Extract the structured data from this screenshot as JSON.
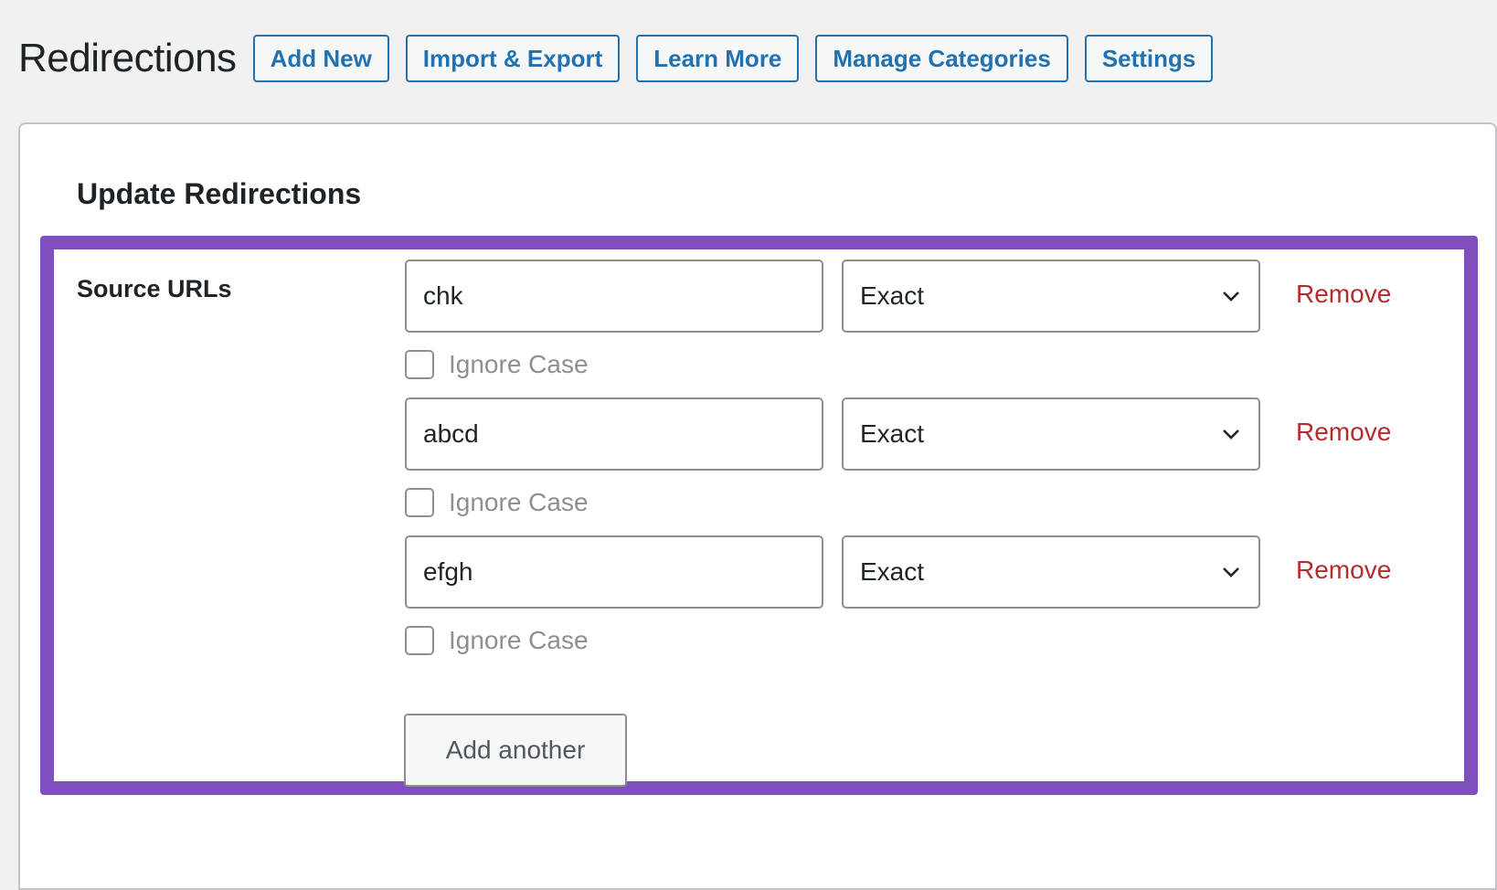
{
  "header": {
    "title": "Redirections",
    "buttons": [
      "Add New",
      "Import & Export",
      "Learn More",
      "Manage Categories",
      "Settings"
    ]
  },
  "card": {
    "title": "Update Redirections",
    "field_label": "Source URLs",
    "rows": [
      {
        "url": "chk",
        "match": "Exact",
        "remove": "Remove",
        "ignore_case": "Ignore Case"
      },
      {
        "url": "abcd",
        "match": "Exact",
        "remove": "Remove",
        "ignore_case": "Ignore Case"
      },
      {
        "url": "efgh",
        "match": "Exact",
        "remove": "Remove",
        "ignore_case": "Ignore Case"
      }
    ],
    "add_another": "Add another"
  },
  "colors": {
    "accent": "#2271b1",
    "highlight": "#7e4fbd",
    "danger": "#b32d2e"
  }
}
